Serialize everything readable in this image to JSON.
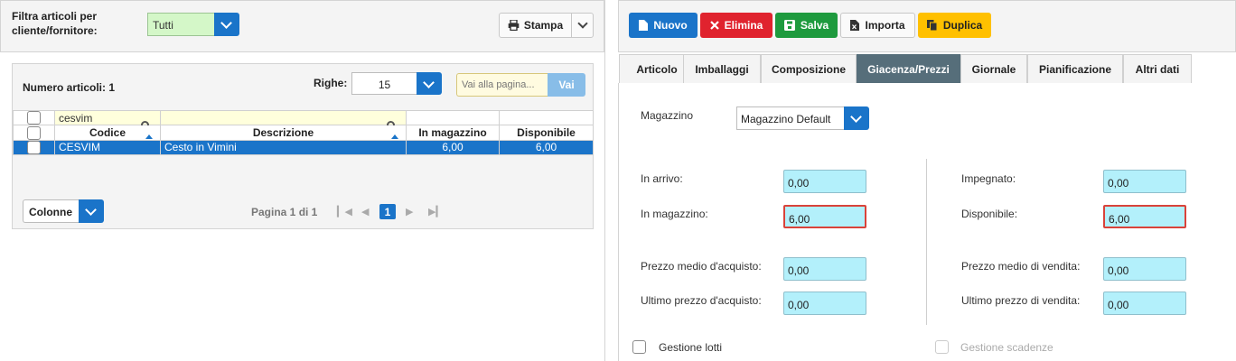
{
  "left": {
    "filter_label": "Filtra articoli per cliente/fornitore:",
    "filter_value": "Tutti",
    "print_button": "Stampa",
    "count_label": "Numero articoli: 1",
    "rows_label": "Righe:",
    "rows_value": "15",
    "goto_placeholder": "Vai alla pagina...",
    "goto_button": "Vai",
    "search_code": "cesvim",
    "columns": [
      "Codice",
      "Descrizione",
      "In magazzino",
      "Disponibile"
    ],
    "rows": [
      {
        "code": "CESVIM",
        "description": "Cesto in Vimini",
        "in_stock": "6,00",
        "available": "6,00"
      }
    ],
    "columns_button": "Colonne",
    "pager_label": "Pagina 1 di 1",
    "current_page": "1"
  },
  "toolbar": {
    "new": "Nuovo",
    "delete": "Elimina",
    "save": "Salva",
    "import": "Importa",
    "duplicate": "Duplica"
  },
  "tabs": [
    "Articolo",
    "Imballaggi",
    "Composizione",
    "Giacenza/Prezzi",
    "Giornale",
    "Pianificazione",
    "Altri dati"
  ],
  "active_tab": "Giacenza/Prezzi",
  "stock": {
    "warehouse_label": "Magazzino",
    "warehouse_value": "Magazzino Default",
    "incoming_label": "In arrivo:",
    "incoming_value": "0,00",
    "committed_label": "Impegnato:",
    "committed_value": "0,00",
    "in_stock_label": "In magazzino:",
    "in_stock_value": "6,00",
    "available_label": "Disponibile:",
    "available_value": "6,00",
    "avg_purchase_label": "Prezzo medio d'acquisto:",
    "avg_purchase_value": "0,00",
    "avg_sale_label": "Prezzo medio di vendita:",
    "avg_sale_value": "0,00",
    "last_purchase_label": "Ultimo prezzo d'acquisto:",
    "last_purchase_value": "0,00",
    "last_sale_label": "Ultimo prezzo di vendita:",
    "last_sale_value": "0,00",
    "lots_label": "Gestione lotti",
    "expiry_label": "Gestione scadenze"
  },
  "colors": {
    "primary": "#1a74c9",
    "danger": "#e0232e",
    "success": "#1e9a3e",
    "warning": "#ffc000",
    "active_tab": "#566e7a",
    "field_bg": "#b3f0fb",
    "highlight_border": "#d9433a"
  }
}
